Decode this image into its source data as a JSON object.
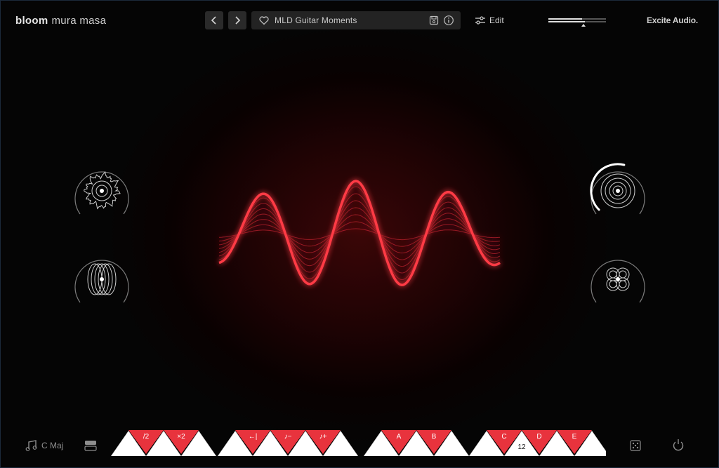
{
  "app": {
    "brand_primary": "bloom",
    "brand_secondary": "mura masa",
    "vendor_logo": "Excite Audio."
  },
  "header": {
    "prev_label": "‹",
    "next_label": "›",
    "preset_name": "MLD Guitar Moments",
    "edit_label": "Edit",
    "icons": [
      "heart-icon",
      "save-icon",
      "info-icon",
      "sliders-icon",
      "volume-meter"
    ]
  },
  "left_knobs": [
    {
      "name": "noise-knob",
      "icon": "fuzzy-circle-icon"
    },
    {
      "name": "orbit-knob",
      "icon": "overlapping-ellipses-icon"
    }
  ],
  "right_knobs": [
    {
      "name": "rings-knob",
      "icon": "concentric-rings-icon",
      "level": 0.55
    },
    {
      "name": "clover-knob",
      "icon": "four-circles-icon"
    }
  ],
  "footer": {
    "key_label": "C Maj",
    "sequencer_buttons": [
      {
        "label": "/2",
        "name": "half-button"
      },
      {
        "label": "×2",
        "name": "double-button"
      },
      {
        "label": "←|",
        "name": "back-button"
      },
      {
        "label": "♪−",
        "name": "note-minus-button"
      },
      {
        "label": "♪+",
        "name": "note-plus-button"
      },
      {
        "label": "A",
        "name": "slot-a-button"
      },
      {
        "label": "B",
        "name": "slot-b-button"
      },
      {
        "label": "C",
        "name": "slot-c-button"
      },
      {
        "label": "D",
        "name": "slot-d-button"
      },
      {
        "label": "E",
        "name": "slot-e-button"
      }
    ],
    "step_count": "12"
  },
  "colors": {
    "accent_red": "#e8333d",
    "wave_red": "#ff3a45",
    "background": "#000000"
  }
}
